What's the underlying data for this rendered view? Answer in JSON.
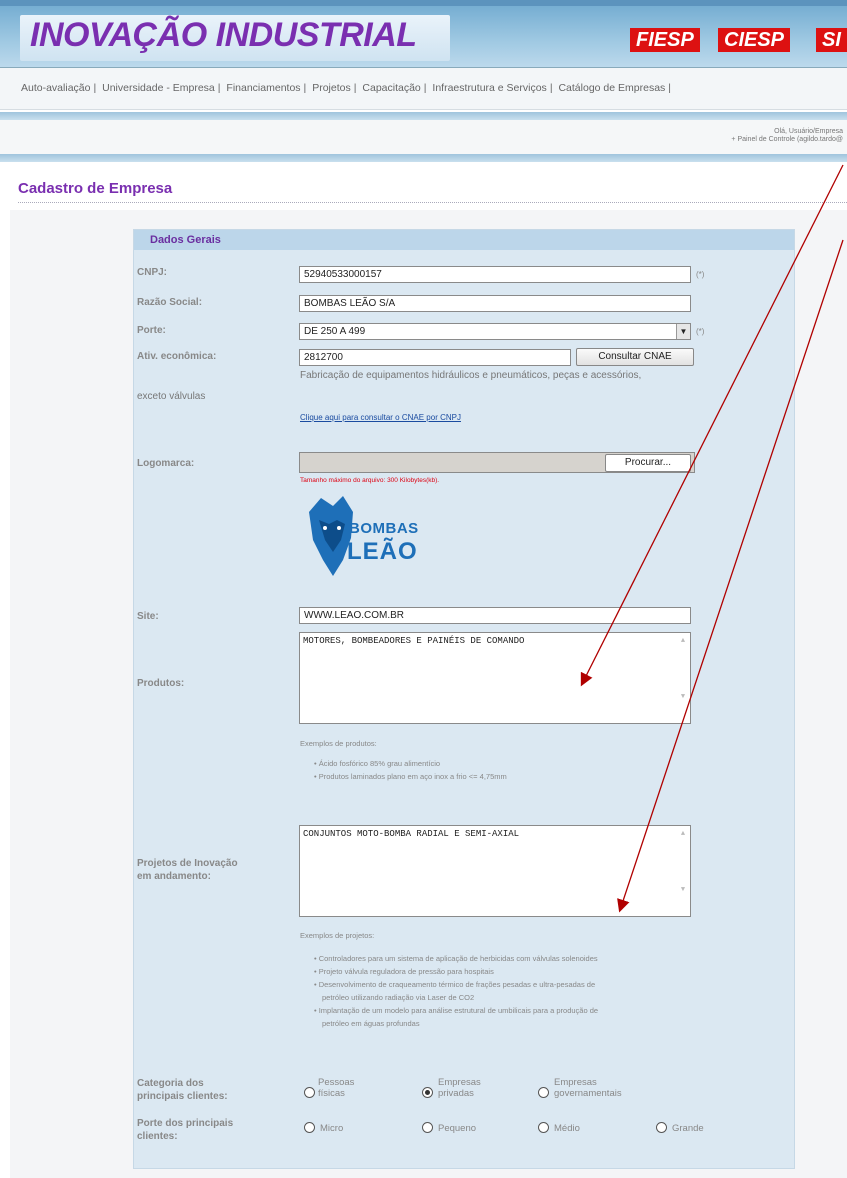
{
  "header": {
    "title": "INOVAÇÃO INDUSTRIAL",
    "logos": [
      "FIESP",
      "CIESP",
      "SI"
    ]
  },
  "nav": {
    "items": [
      "Auto-avaliação",
      "Universidade - Empresa",
      "Financiamentos",
      "Projetos",
      "Capacitação",
      "Infraestrutura e Serviços",
      "Catálogo de Empresas"
    ]
  },
  "user": {
    "greeting": "Olá, Usuário/Empresa",
    "panel": "+ Painel de Controle (agildo.tardo@"
  },
  "page": {
    "title": "Cadastro de Empresa"
  },
  "form": {
    "section": "Dados Gerais",
    "cnpj_label": "CNPJ:",
    "cnpj_value": "52940533000157",
    "req": "(*)",
    "razao_label": "Razão Social:",
    "razao_value": "BOMBAS LEÃO S/A",
    "porte_label": "Porte:",
    "porte_value": "DE 250 A 499",
    "ativ_label": "Ativ. econômica:",
    "ativ_value": "2812700",
    "consultar": "Consultar CNAE",
    "ativ_desc1": "Fabricação de equipamentos hidráulicos e pneumáticos, peças e acessórios,",
    "ativ_desc2": "exceto válvulas",
    "cnae_link": "Clique aqui para consultar o CNAE por CNPJ",
    "logo_label": "Logomarca:",
    "procurar": "Procurar...",
    "max_size": "Tamanho máximo do arquivo: 300 Kilobytes(kb).",
    "logo_text1": "BOMBAS",
    "logo_text2": "LEÃO",
    "site_label": "Site:",
    "site_value": "WWW.LEAO.COM.BR",
    "produtos_label": "Produtos:",
    "produtos_value": "MOTORES, BOMBEADORES E PAINÉIS DE COMANDO",
    "produtos_ex": "Exemplos de produtos:",
    "produtos_list": [
      "Ácido fosfórico 85% grau alimentício",
      "Produtos laminados plano em aço inox a frio <= 4,75mm"
    ],
    "projetos_label1": "Projetos de Inovação",
    "projetos_label2": "em andamento:",
    "projetos_value": "CONJUNTOS MOTO-BOMBA RADIAL E SEMI-AXIAL",
    "projetos_ex": "Exemplos de projetos:",
    "projetos_list": [
      "Controladores para um sistema de aplicação de herbicidas com válvulas solenoides",
      "Projeto válvula reguladora de pressão para hospitais",
      "Desenvolvimento de craqueamento térmico de frações pesadas e ultra-pesadas de",
      "petróleo utilizando radiação via Laser de CO2",
      "Implantação de um modelo para análise estrutural de umbilicais para a produção de",
      "petróleo em águas profundas"
    ],
    "cat_label1": "Categoria dos",
    "cat_label2": "principais clientes:",
    "cat_opts": [
      [
        "Pessoas",
        "físicas"
      ],
      [
        "Empresas",
        "privadas"
      ],
      [
        "Empresas",
        "governamentais"
      ]
    ],
    "porte_cli_label1": "Porte dos principais",
    "porte_cli_label2": "clientes:",
    "porte_opts": [
      "Micro",
      "Pequeno",
      "Médio",
      "Grande"
    ]
  },
  "colors": {
    "accent": "#7a2fb0",
    "arrow": "#b00000"
  }
}
